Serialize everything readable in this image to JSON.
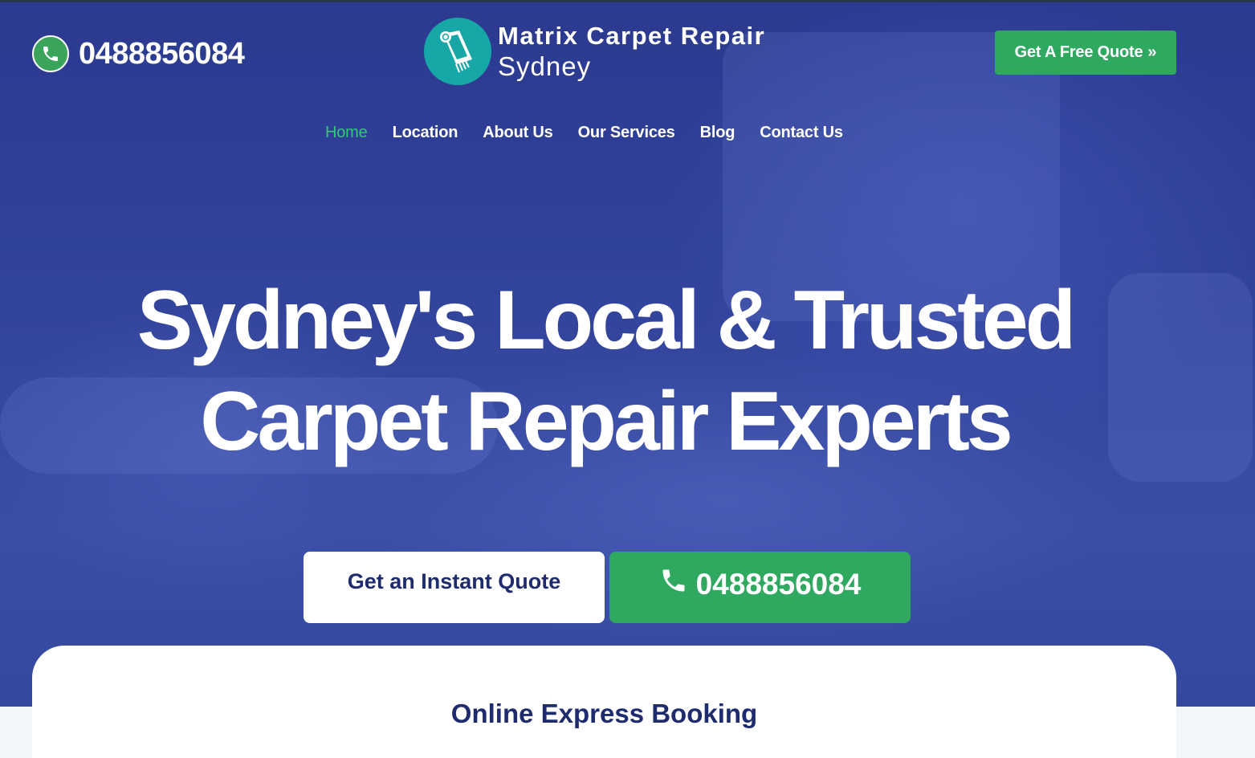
{
  "header": {
    "phone": "0488856084",
    "logo": {
      "line1": "Matrix Carpet Repair",
      "line2": "Sydney"
    },
    "quote_button": "Get A Free Quote",
    "quote_button_icon": "double-chevron-right-icon"
  },
  "nav": {
    "items": [
      {
        "label": "Home",
        "active": true
      },
      {
        "label": "Location",
        "active": false
      },
      {
        "label": "About Us",
        "active": false
      },
      {
        "label": "Our Services",
        "active": false
      },
      {
        "label": "Blog",
        "active": false
      },
      {
        "label": "Contact Us",
        "active": false
      }
    ]
  },
  "hero": {
    "headline_line1": "Sydney's Local & Trusted",
    "headline_line2": "Carpet Repair Experts",
    "cta_quote": "Get an Instant Quote",
    "cta_phone": "0488856084"
  },
  "booking": {
    "title": "Online Express Booking"
  },
  "colors": {
    "hero_blue": "#33449c",
    "accent_green": "#2fa860",
    "nav_active": "#34c57a",
    "logo_teal": "#16a7a6",
    "dark_text": "#1e2b6e"
  }
}
